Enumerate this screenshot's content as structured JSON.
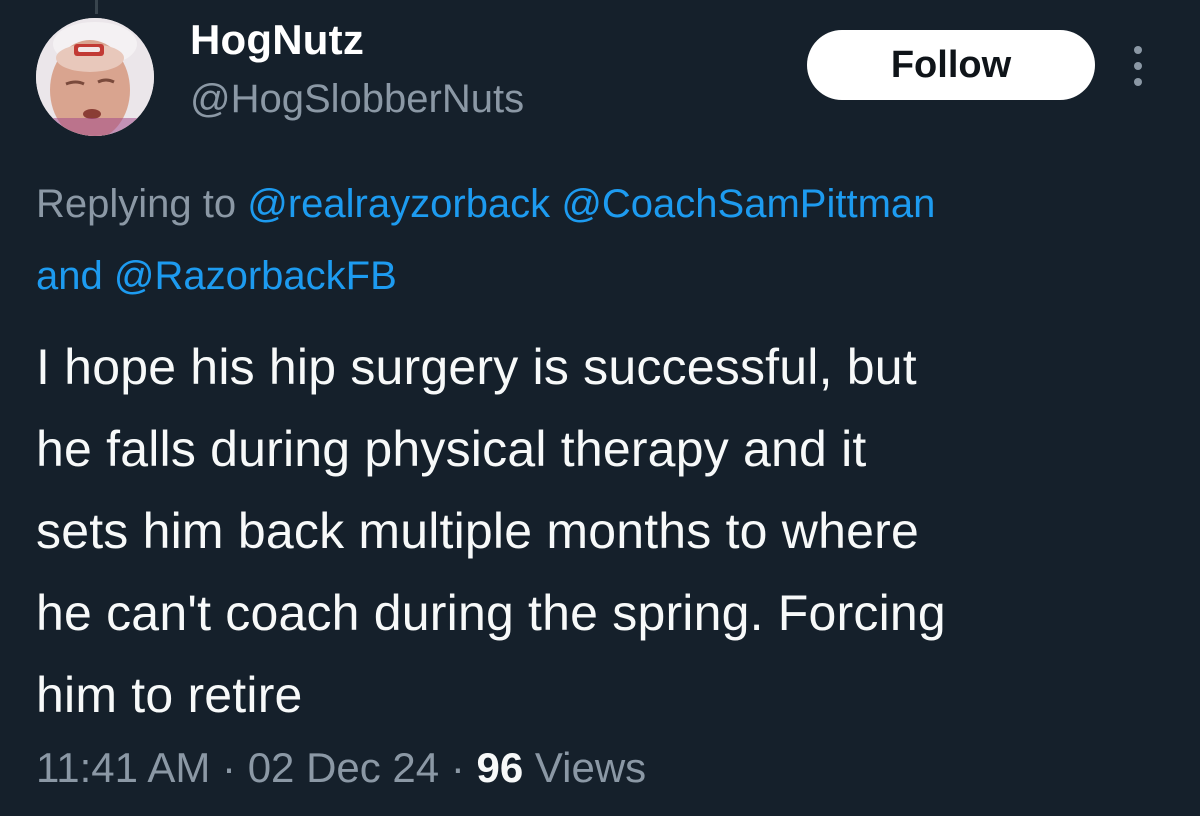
{
  "author": {
    "display_name": "HogNutz",
    "handle": "@HogSlobberNuts",
    "avatar_icon": "profile-photo"
  },
  "follow_button": {
    "label": "Follow"
  },
  "more_icon": "more-vertical-icon",
  "reply_context": {
    "prefix": "Replying to",
    "mentions": [
      "@realrayzorback",
      "@CoachSamPittman",
      "@RazorbackFB"
    ],
    "conjunction": "and"
  },
  "tweet": {
    "lines": [
      "I hope his hip surgery is successful, but",
      "he falls during physical therapy and it",
      "sets him back multiple months to where",
      "he can't coach during the spring. Forcing",
      "him to retire"
    ]
  },
  "meta": {
    "time": "11:41 AM",
    "separator": "·",
    "date": "02 Dec 24",
    "views_count": "96",
    "views_label": "Views"
  },
  "colors": {
    "background": "#15202b",
    "accent": "#1d9bf0",
    "secondary_text": "#8b98a5",
    "primary_text": "#f7f9f9"
  }
}
